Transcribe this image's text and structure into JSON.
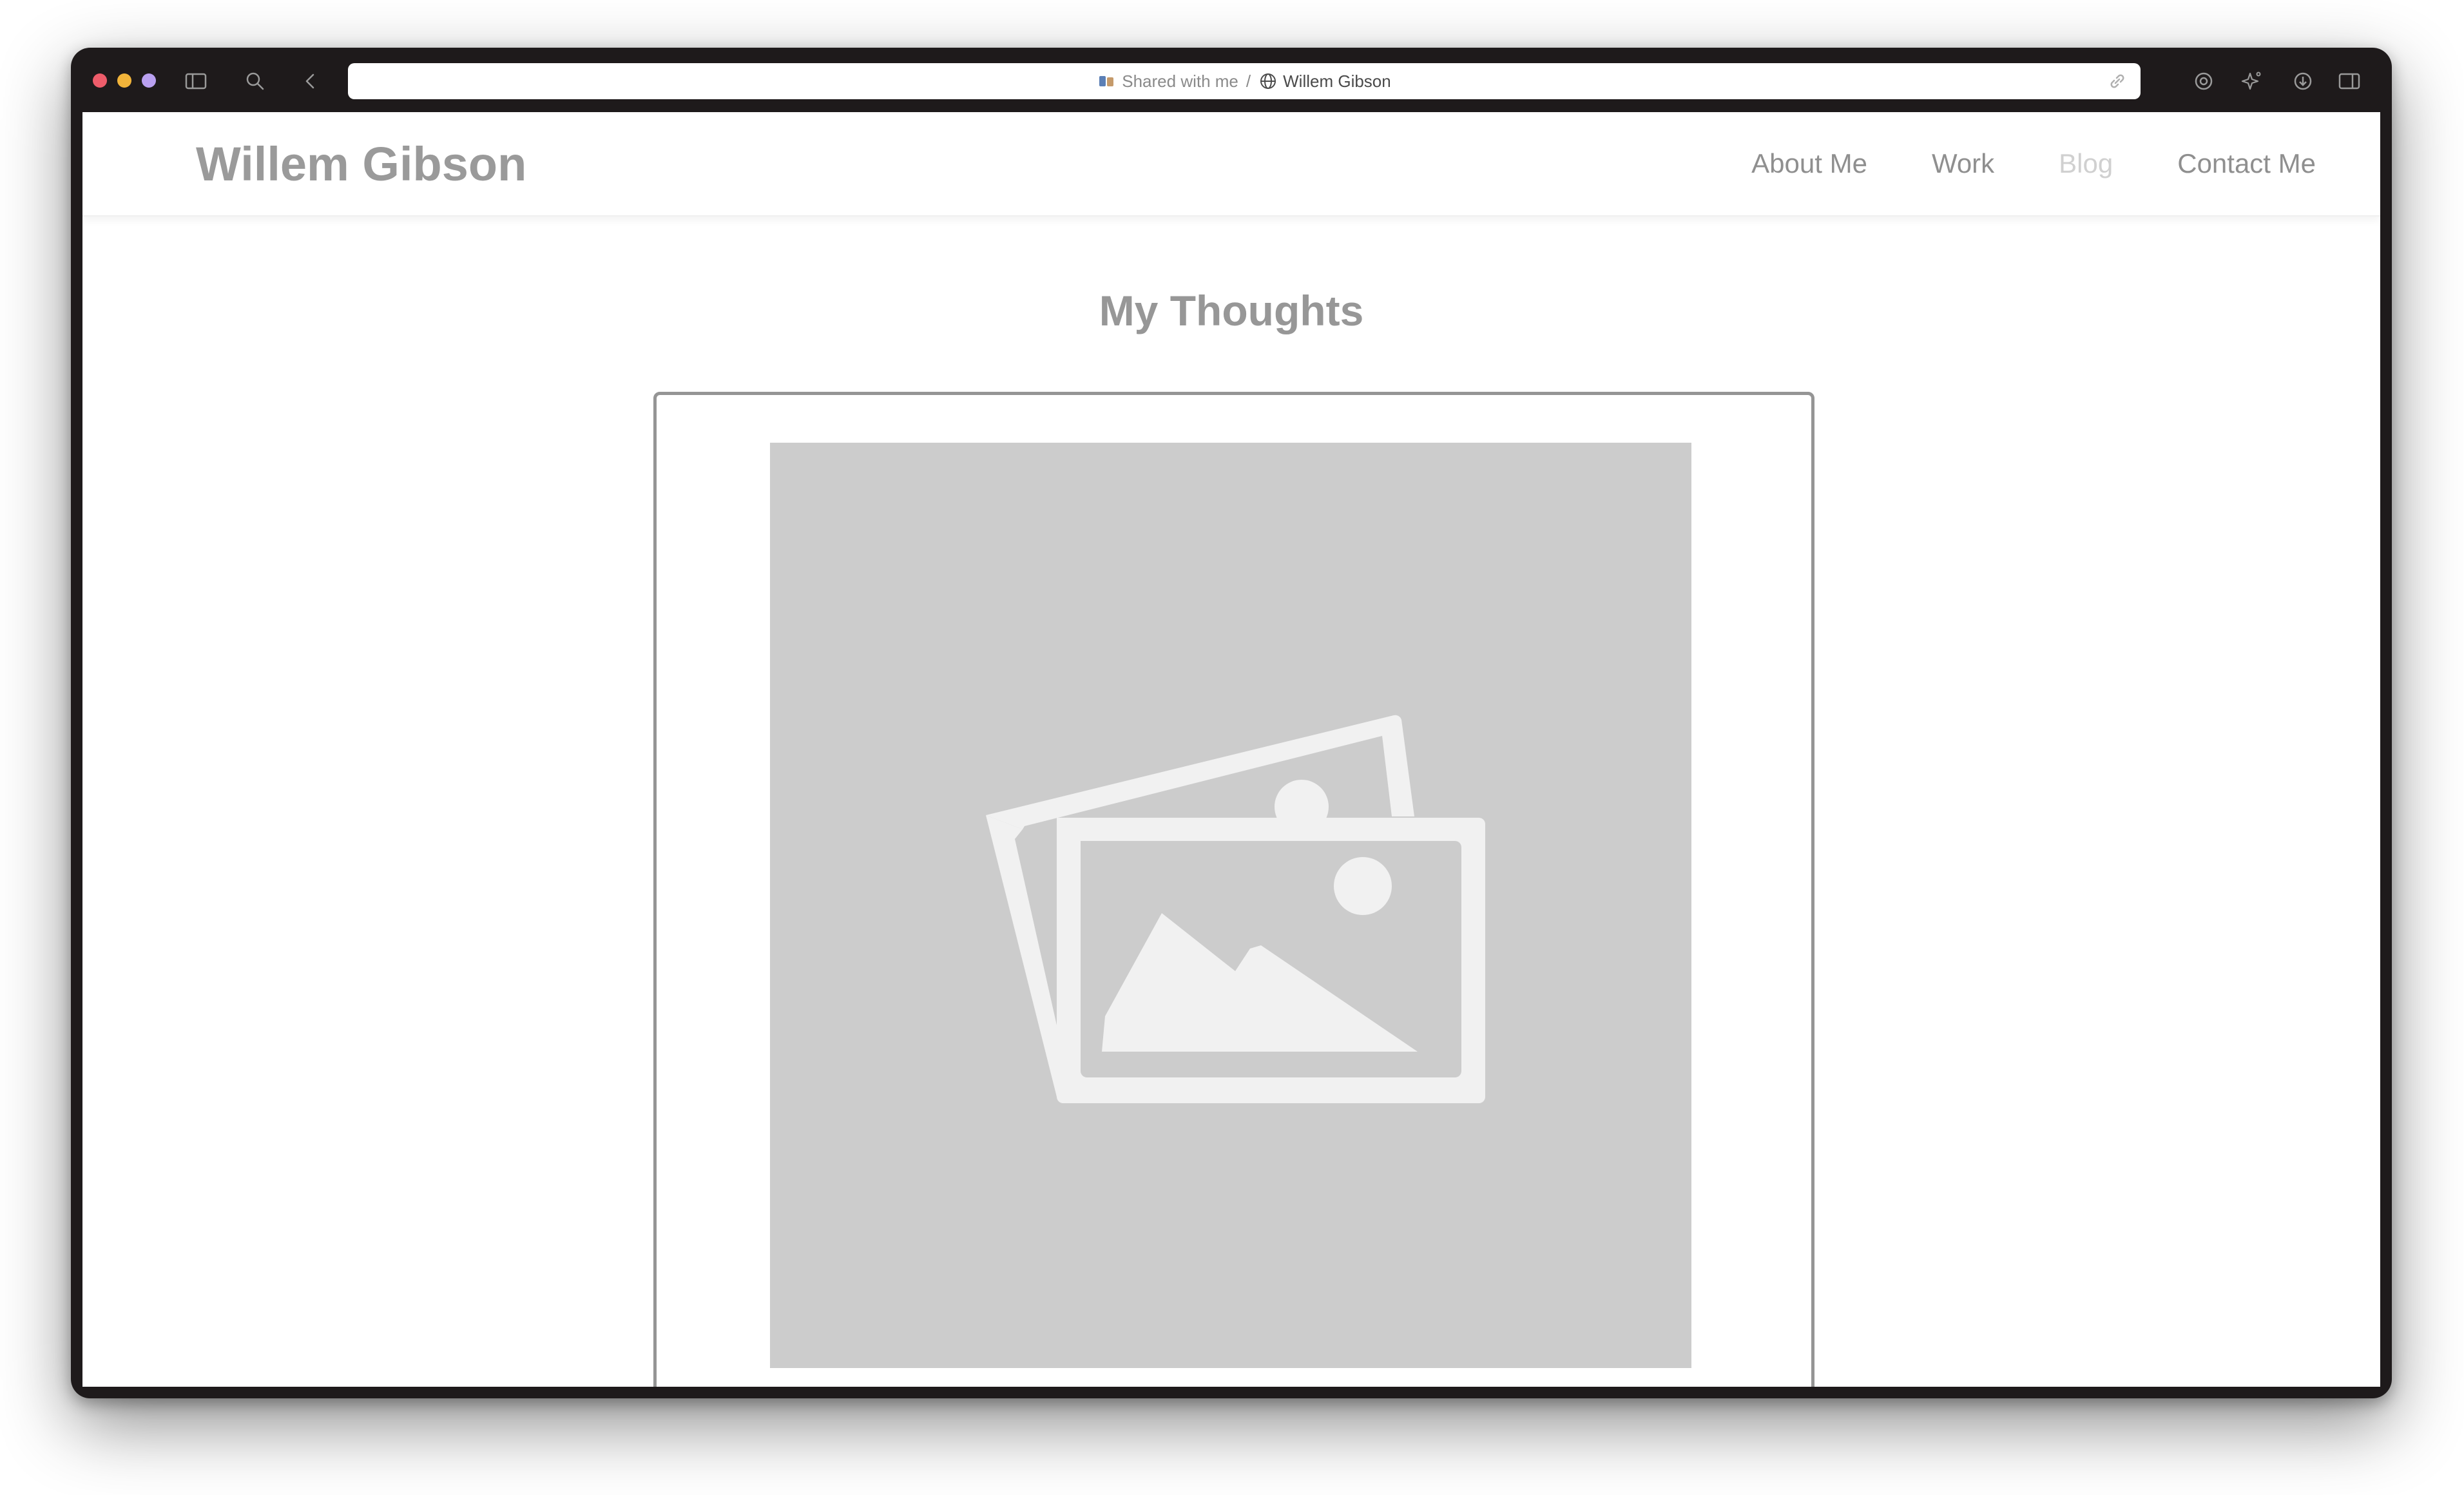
{
  "browser": {
    "address_bar": {
      "shared_label": "Shared with me",
      "separator": "/",
      "page_title": "Willem Gibson"
    },
    "traffic_lights": {
      "close": "#ee5c6a",
      "minimize": "#f2b43a",
      "zoom": "#b9a0f0"
    },
    "toolbar_icons": [
      "sidebar-icon",
      "search-icon",
      "back-icon",
      "extension-icon",
      "sparkle-icon",
      "download-icon",
      "sidebar-right-icon"
    ]
  },
  "site": {
    "name": "Willem Gibson",
    "nav": [
      {
        "label": "About Me",
        "active": false
      },
      {
        "label": "Work",
        "active": false
      },
      {
        "label": "Blog",
        "active": true
      },
      {
        "label": "Contact Me",
        "active": false
      }
    ]
  },
  "main": {
    "heading": "My Thoughts",
    "card": {
      "image": "image-placeholder-icon"
    }
  }
}
